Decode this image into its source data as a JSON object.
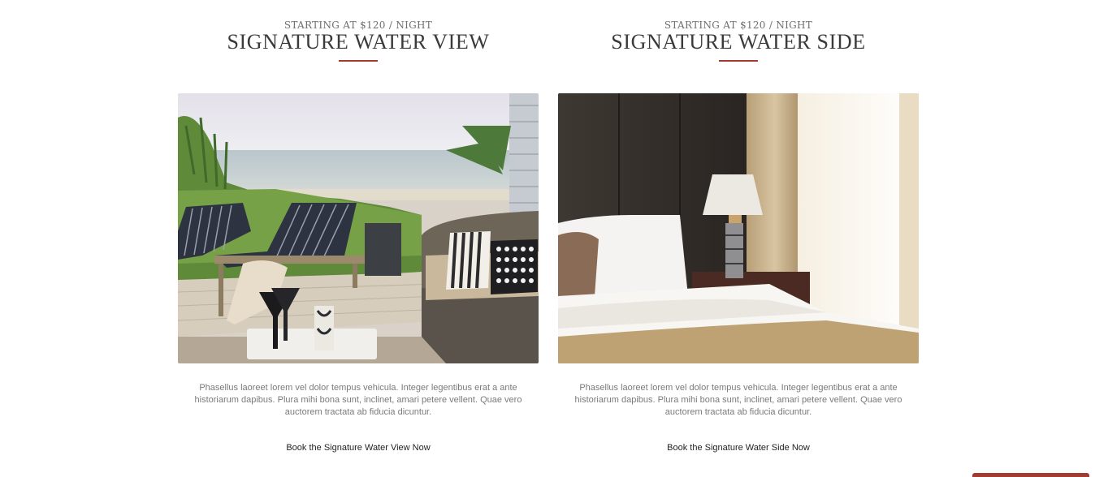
{
  "rooms": [
    {
      "eyebrow": "STARTING AT $120 / NIGHT",
      "title": "SIGNATURE WATER VIEW",
      "image": "beach-patio-lounge-photo",
      "description": "Phasellus laoreet lorem vel dolor tempus vehicula. Integer legentibus erat a ante historiarum dapibus. Plura mihi bona sunt, inclinet, amari petere vellent. Quae vero auctorem tractata ab fiducia dicuntur.",
      "cta": "Book the Signature Water View Now"
    },
    {
      "eyebrow": "STARTING AT $120 / NIGHT",
      "title": "SIGNATURE WATER SIDE",
      "image": "hotel-bedroom-photo",
      "description": "Phasellus laoreet lorem vel dolor tempus vehicula. Integer legentibus erat a ante historiarum dapibus. Plura mihi bona sunt, inclinet, amari petere vellent. Quae vero auctorem tractata ab fiducia dicuntur.",
      "cta": "Book the Signature Water Side Now"
    }
  ],
  "colors": {
    "accent": "#a23b32",
    "heading": "#3a3a3a",
    "body_text": "#7a7a7a"
  }
}
